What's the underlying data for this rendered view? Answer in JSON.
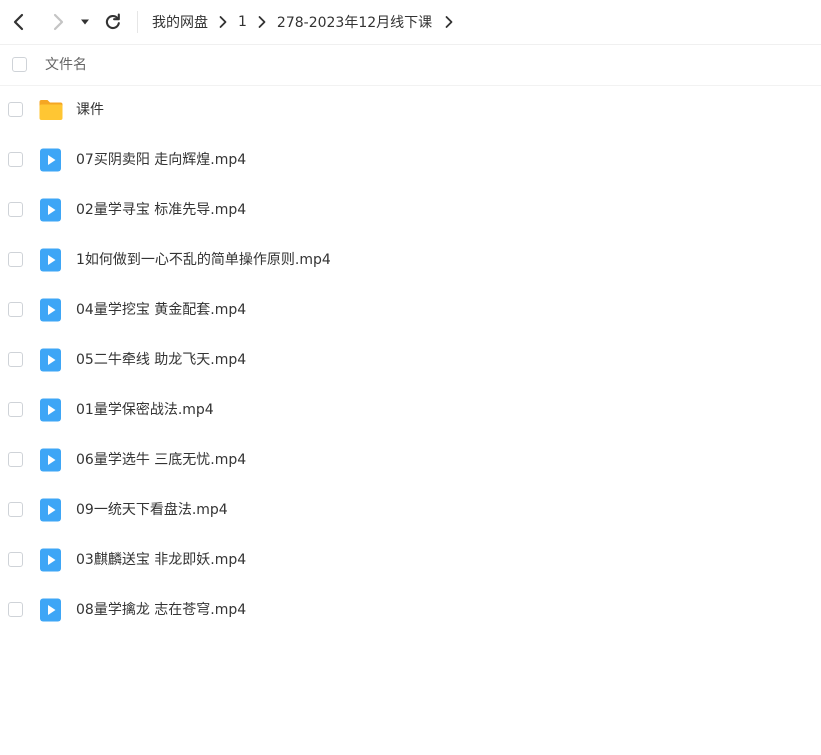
{
  "navigation": {
    "back_icon": "chevron-left-icon",
    "forward_icon": "chevron-right-icon",
    "dropdown_icon": "caret-down-icon",
    "refresh_icon": "refresh-icon"
  },
  "breadcrumb": {
    "items": [
      "我的网盘",
      "1",
      "278-2023年12月线下课"
    ],
    "separator_icon": "chevron-right-icon"
  },
  "list_header": {
    "name_column": "文件名"
  },
  "files": [
    {
      "name": "课件",
      "type": "folder",
      "icon": "folder-icon"
    },
    {
      "name": "07买阴卖阳 走向辉煌.mp4",
      "type": "video",
      "icon": "video-file-icon"
    },
    {
      "name": "02量学寻宝 标准先导.mp4",
      "type": "video",
      "icon": "video-file-icon"
    },
    {
      "name": "1如何做到一心不乱的简单操作原则.mp4",
      "type": "video",
      "icon": "video-file-icon"
    },
    {
      "name": "04量学挖宝 黄金配套.mp4",
      "type": "video",
      "icon": "video-file-icon"
    },
    {
      "name": "05二牛牵线 助龙飞天.mp4",
      "type": "video",
      "icon": "video-file-icon"
    },
    {
      "name": "01量学保密战法.mp4",
      "type": "video",
      "icon": "video-file-icon"
    },
    {
      "name": "06量学选牛 三底无忧.mp4",
      "type": "video",
      "icon": "video-file-icon"
    },
    {
      "name": "09一统天下看盘法.mp4",
      "type": "video",
      "icon": "video-file-icon"
    },
    {
      "name": "03麒麟送宝 非龙即妖.mp4",
      "type": "video",
      "icon": "video-file-icon"
    },
    {
      "name": "08量学擒龙 志在苍穹.mp4",
      "type": "video",
      "icon": "video-file-icon"
    }
  ],
  "colors": {
    "folder": "#FFC633",
    "folder_back": "#F5A623",
    "video": "#3EA6F6",
    "text": "#333333",
    "header_text": "#666666"
  }
}
